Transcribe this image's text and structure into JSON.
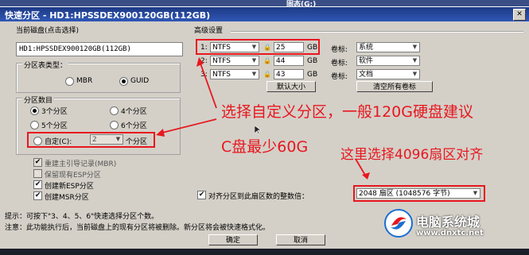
{
  "background_window": {
    "title": "固态(G:)"
  },
  "dialog": {
    "title": "快速分区 - HD1:HPSSDEX900120GB(112GB)",
    "current_disk": {
      "label": "当前磁盘(点击选择)",
      "value": "HD1:HPSSDEX900120GB(112GB)"
    },
    "partition_table": {
      "label": "分区表类型：",
      "options": [
        "MBR",
        "GUID"
      ],
      "selected": "GUID"
    },
    "partition_count": {
      "label": "分区数目",
      "options": [
        "3个分区",
        "4个分区",
        "5个分区",
        "6个分区"
      ],
      "selected": "3个分区",
      "custom_label": "自定(C):",
      "custom_value": "2",
      "custom_suffix": "个分区"
    },
    "options": [
      {
        "label": "重建主引导记录(MBR)",
        "checked": true,
        "disabled": true
      },
      {
        "label": "保留现有ESP分区",
        "checked": false,
        "disabled": true
      },
      {
        "label": "创建新ESP分区",
        "checked": true,
        "disabled": false
      },
      {
        "label": "创建MSR分区",
        "checked": true,
        "disabled": false
      }
    ],
    "advanced": {
      "label": "高级设置",
      "rows": [
        {
          "index": "1:",
          "fs": "NTFS",
          "size": "25",
          "unit": "GB",
          "vol_label_caption": "卷标:",
          "vol_label": "系统"
        },
        {
          "index": "2:",
          "fs": "NTFS",
          "size": "44",
          "unit": "GB",
          "vol_label_caption": "卷标:",
          "vol_label": "软件"
        },
        {
          "index": "3:",
          "fs": "NTFS",
          "size": "43",
          "unit": "GB",
          "vol_label_caption": "卷标:",
          "vol_label": "文档"
        }
      ],
      "default_size_button": "默认大小",
      "clear_labels_button": "清空所有卷标"
    },
    "align": {
      "label": "对齐分区到此扇区数的整数倍：",
      "checked": true,
      "value": "2048 扇区 (1048576 字节)"
    },
    "tip": "提示：可按下\"3、4、5、6\"快速选择分区个数。",
    "note": "注意：此功能执行后，当前磁盘上的现有分区将被删除。新分区将会被快速格式化。",
    "ok_button": "确定",
    "cancel_button": "取消"
  },
  "annotations": {
    "line1": "选择自定义分区，一般120G硬盘建议",
    "line2": "C盘最少60G",
    "line3": "这里选择4096扇区对齐",
    "color": "#e8171f"
  },
  "watermark": {
    "name": "电脑系统城",
    "url": "www.dnxtc.net"
  },
  "icons": {
    "close": "close-icon",
    "lock": "lock-icon",
    "dropdown": "chevron-down-icon",
    "logo": "logo-icon",
    "cursor": "mouse-cursor-icon"
  }
}
